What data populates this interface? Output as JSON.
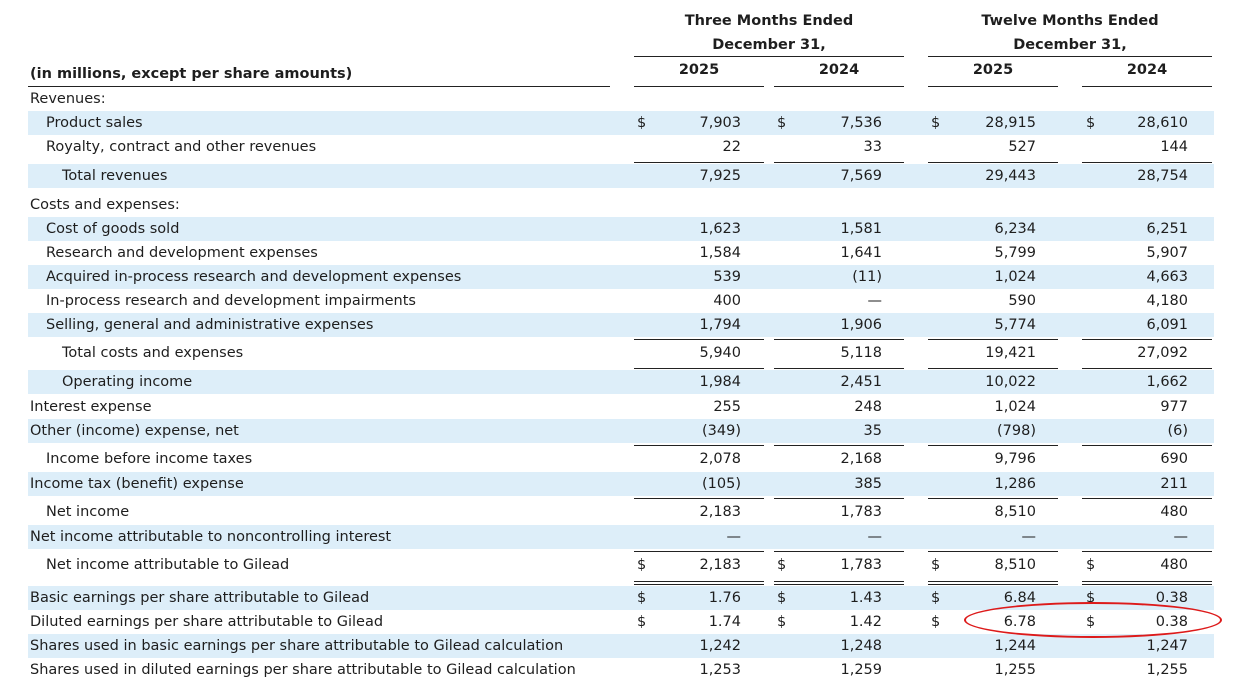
{
  "header": {
    "group1_line1": "Three Months Ended",
    "group1_line2": "December 31,",
    "group2_line1": "Twelve Months Ended",
    "group2_line2": "December 31,",
    "units": "(in millions, except per share amounts)",
    "years": [
      "2025",
      "2024",
      "2025",
      "2024"
    ]
  },
  "rows": [
    {
      "label": "Revenues:",
      "values": []
    },
    {
      "label": "Product sales",
      "values": [
        "7,903",
        "7,536",
        "28,915",
        "28,610"
      ],
      "dollar": true
    },
    {
      "label": "Royalty, contract and other revenues",
      "values": [
        "22",
        "33",
        "527",
        "144"
      ]
    },
    {
      "label": "Total revenues",
      "values": [
        "7,925",
        "7,569",
        "29,443",
        "28,754"
      ]
    },
    {
      "label": "Costs and expenses:",
      "values": []
    },
    {
      "label": "Cost of goods sold",
      "values": [
        "1,623",
        "1,581",
        "6,234",
        "6,251"
      ]
    },
    {
      "label": "Research and development expenses",
      "values": [
        "1,584",
        "1,641",
        "5,799",
        "5,907"
      ]
    },
    {
      "label": "Acquired in-process research and development expenses",
      "values": [
        "539",
        "(11)",
        "1,024",
        "4,663"
      ]
    },
    {
      "label": "In-process research and development impairments",
      "values": [
        "400",
        "—",
        "590",
        "4,180"
      ]
    },
    {
      "label": "Selling, general and administrative expenses",
      "values": [
        "1,794",
        "1,906",
        "5,774",
        "6,091"
      ]
    },
    {
      "label": "Total costs and expenses",
      "values": [
        "5,940",
        "5,118",
        "19,421",
        "27,092"
      ]
    },
    {
      "label": "Operating income",
      "values": [
        "1,984",
        "2,451",
        "10,022",
        "1,662"
      ]
    },
    {
      "label": "Interest expense",
      "values": [
        "255",
        "248",
        "1,024",
        "977"
      ]
    },
    {
      "label": "Other (income) expense, net",
      "values": [
        "(349)",
        "35",
        "(798)",
        "(6)"
      ]
    },
    {
      "label": "Income before income taxes",
      "values": [
        "2,078",
        "2,168",
        "9,796",
        "690"
      ]
    },
    {
      "label": "Income tax (benefit) expense",
      "values": [
        "(105)",
        "385",
        "1,286",
        "211"
      ]
    },
    {
      "label": "Net income",
      "values": [
        "2,183",
        "1,783",
        "8,510",
        "480"
      ]
    },
    {
      "label": "Net income attributable to noncontrolling interest",
      "values": [
        "—",
        "—",
        "—",
        "—"
      ]
    },
    {
      "label": "Net income attributable to Gilead",
      "values": [
        "2,183",
        "1,783",
        "8,510",
        "480"
      ],
      "dollar": true
    },
    {
      "label": "Basic earnings per share attributable to Gilead",
      "values": [
        "1.76",
        "1.43",
        "6.84",
        "0.38"
      ],
      "dollar": true
    },
    {
      "label": "Diluted earnings per share attributable to Gilead",
      "values": [
        "1.74",
        "1.42",
        "6.78",
        "0.38"
      ],
      "dollar": true
    },
    {
      "label": "Shares used in basic earnings per share attributable to Gilead calculation",
      "values": [
        "1,242",
        "1,248",
        "1,244",
        "1,247"
      ]
    },
    {
      "label": "Shares used in diluted earnings per share attributable to Gilead calculation",
      "values": [
        "1,253",
        "1,259",
        "1,255",
        "1,255"
      ]
    }
  ],
  "currency_symbol": "$",
  "annotation": {
    "highlight_color": "#dd1a1a",
    "highlighted_row": "Diluted earnings per share attributable to Gilead",
    "highlighted_columns": [
      "2025 twelve months",
      "2024 twelve months"
    ]
  }
}
